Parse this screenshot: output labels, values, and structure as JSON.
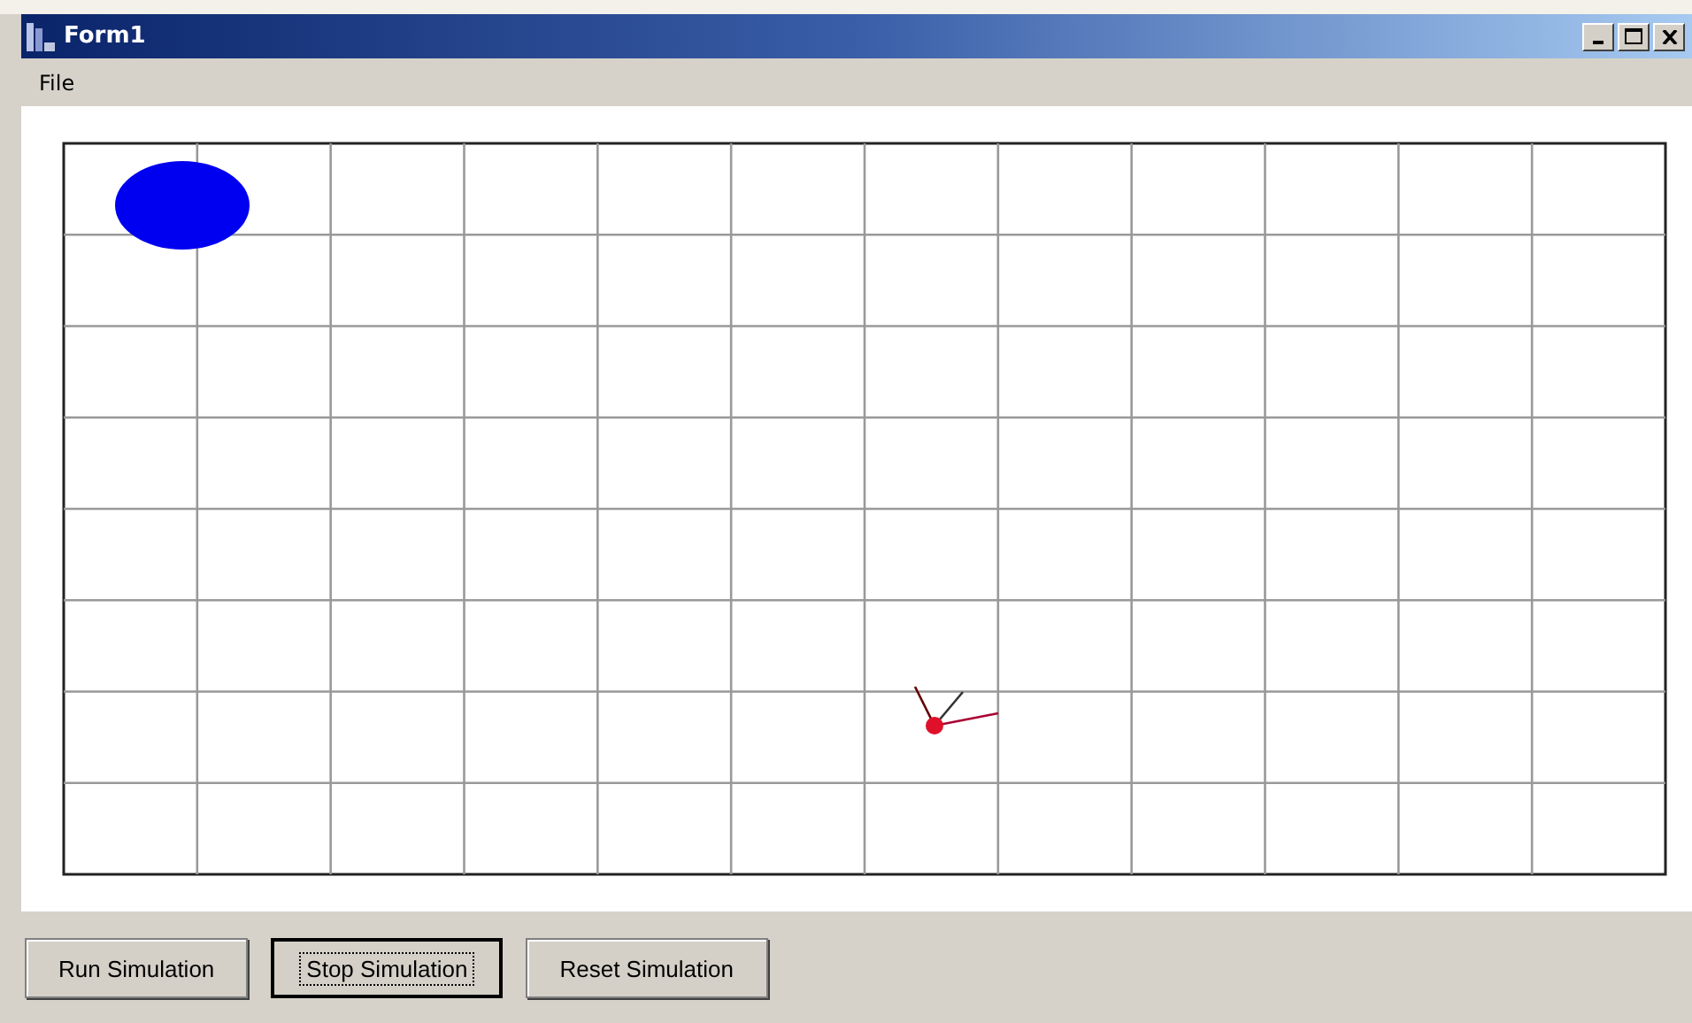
{
  "window": {
    "title": "Form1"
  },
  "menu": [
    "File"
  ],
  "buttons": [
    {
      "label": "Run Simulation",
      "focused": false
    },
    {
      "label": "Stop Simulation",
      "focused": true
    },
    {
      "label": "Reset Simulation",
      "focused": false
    }
  ]
}
